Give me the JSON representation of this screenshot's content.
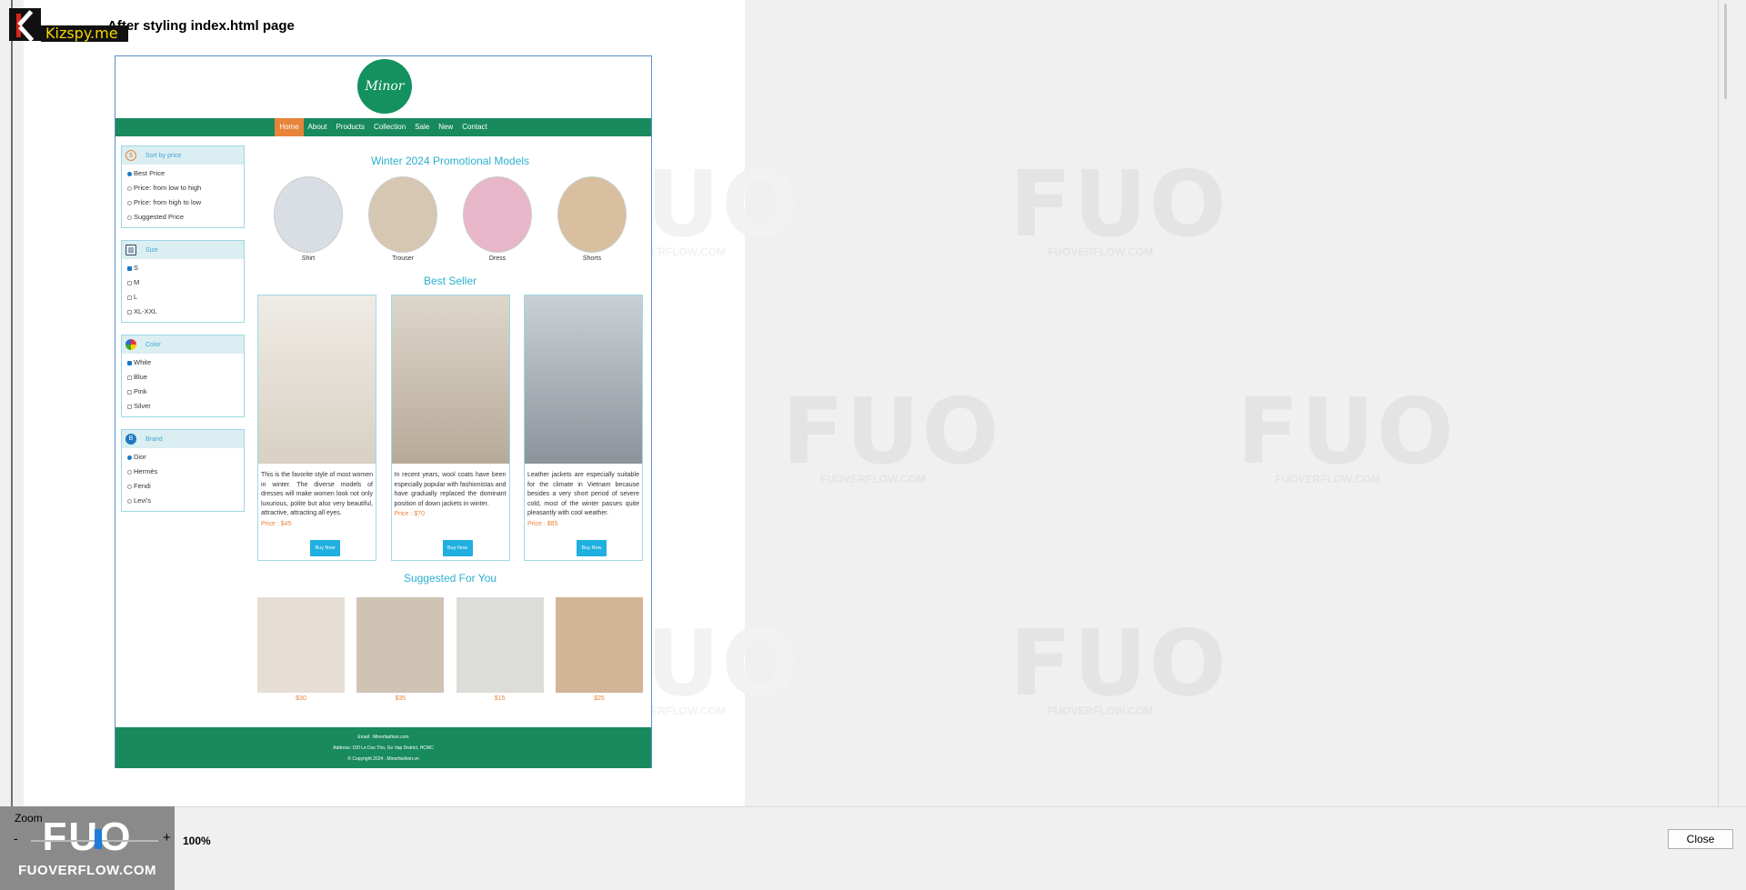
{
  "page_heading": "After styling index.html page",
  "kizspy_text": "Kizspy.me",
  "site": {
    "brand": "Minor",
    "nav": [
      "Home",
      "About",
      "Products",
      "Collection",
      "Sale",
      "New",
      "Contact"
    ],
    "filters": [
      {
        "title": "Sort by price",
        "icon": "price-icon",
        "options": [
          "Best Price",
          "Price: from low to high",
          "Price: from high to low",
          "Suggested Price"
        ]
      },
      {
        "title": "Size",
        "icon": "size-icon",
        "options": [
          "S",
          "M",
          "L",
          "XL-XXL"
        ]
      },
      {
        "title": "Color",
        "icon": "color-icon",
        "options": [
          "White",
          "Blue",
          "Pink",
          "Silver"
        ]
      },
      {
        "title": "Brand",
        "icon": "brand-icon",
        "options": [
          "Dior",
          "Hermès",
          "Fendi",
          "Levi's"
        ]
      }
    ],
    "promo_title": "Winter 2024 Promotional Models",
    "promo": [
      {
        "label": "Shirt",
        "color": "#d9dde4"
      },
      {
        "label": "Trouser",
        "color": "#d6c7b3"
      },
      {
        "label": "Dress",
        "color": "#e7b7c9"
      },
      {
        "label": "Shorts",
        "color": "#d8bf9f"
      }
    ],
    "bestseller_title": "Best Seller",
    "bestsellers": [
      {
        "desc": "This is the favorite style of most women in winter. The diverse models of dresses will make women look not only luxurious, polite but also very beautiful, attractive, attracting all eyes.",
        "price": "Price : $45",
        "buy": "Buy Now",
        "color": "#e6e0d6"
      },
      {
        "desc": "In recent years, wool coats have been especially popular with fashionistas and have gradually replaced the dominant position of down jackets in winter.",
        "price": "Price : $70",
        "buy": "Buy Now",
        "color": "#c8bfb2"
      },
      {
        "desc": "Leather jackets are especially suitable for the climate in Vietnam because besides a very short period of severe cold, most of the winter passes quite pleasantly with cool weather.",
        "price": "Price : $85",
        "buy": "Buy Now",
        "color": "#aab1b8"
      }
    ],
    "suggested_title": "Suggested For You",
    "suggested": [
      {
        "price": "$30",
        "color": "#d9cfc4"
      },
      {
        "price": "$35",
        "color": "#c6bcae"
      },
      {
        "price": "$15",
        "color": "#d6d6d2"
      },
      {
        "price": "$25",
        "color": "#c9a98b"
      }
    ],
    "footer": {
      "email": "Email : Minorfashion.com",
      "address": "Address: 150 Le Duc Tho, Go Vap District, HCMC",
      "copyright": "© Copyright 2024 . Minorfashion.vn"
    }
  },
  "watermark": {
    "big": "FUO",
    "small": "FUOVERFLOW.COM"
  },
  "zoom": {
    "label": "Zoom",
    "minus": "-",
    "plus": "+",
    "value": "100%"
  },
  "close_label": "Close",
  "accent": "#188a5e",
  "highlight": "#e8833a"
}
